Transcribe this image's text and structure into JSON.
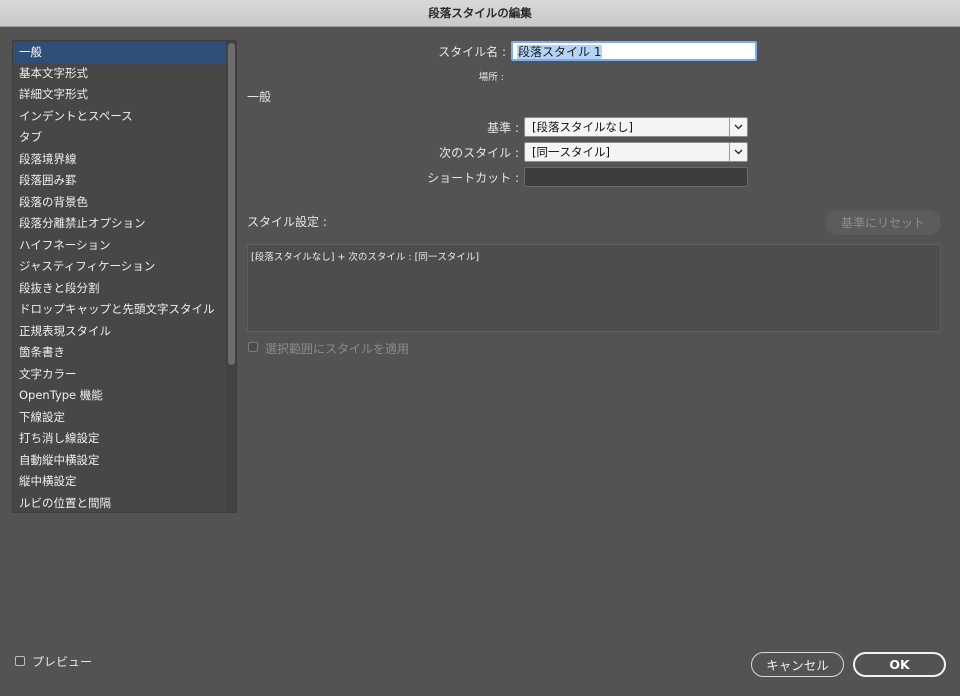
{
  "window": {
    "title": "段落スタイルの編集"
  },
  "sidebar": {
    "items": [
      {
        "label": "一般",
        "selected": true
      },
      {
        "label": "基本文字形式"
      },
      {
        "label": "詳細文字形式"
      },
      {
        "label": "インデントとスペース"
      },
      {
        "label": "タブ"
      },
      {
        "label": "段落境界線"
      },
      {
        "label": "段落囲み罫"
      },
      {
        "label": "段落の背景色"
      },
      {
        "label": "段落分離禁止オプション"
      },
      {
        "label": "ハイフネーション"
      },
      {
        "label": "ジャスティフィケーション"
      },
      {
        "label": "段抜きと段分割"
      },
      {
        "label": "ドロップキャップと先頭文字スタイル"
      },
      {
        "label": "正規表現スタイル"
      },
      {
        "label": "箇条書き"
      },
      {
        "label": "文字カラー"
      },
      {
        "label": "OpenType 機能"
      },
      {
        "label": "下線設定"
      },
      {
        "label": "打ち消し線設定"
      },
      {
        "label": "自動縦中横設定"
      },
      {
        "label": "縦中横設定"
      },
      {
        "label": "ルビの位置と間隔"
      }
    ]
  },
  "form": {
    "style_name_label": "スタイル名 :",
    "style_name_value": "段落スタイル 1",
    "location_label": "場所 :",
    "section_title": "一般",
    "based_on_label": "基準 :",
    "based_on_value": "[段落スタイルなし]",
    "next_style_label": "次のスタイル :",
    "next_style_value": "[同一スタイル]",
    "shortcut_label": "ショートカット :",
    "shortcut_value": "",
    "style_settings_label": "スタイル設定 :",
    "reset_button": "基準にリセット",
    "style_settings_text": "[段落スタイルなし] + 次のスタイル : [同一スタイル]",
    "apply_to_selection_label": "選択範囲にスタイルを適用"
  },
  "footer": {
    "preview_label": "プレビュー",
    "cancel_button": "キャンセル",
    "ok_button": "OK"
  },
  "colors": {
    "background": "#535353",
    "selection": "#2f4f78",
    "focus_ring": "#7eaee9"
  }
}
